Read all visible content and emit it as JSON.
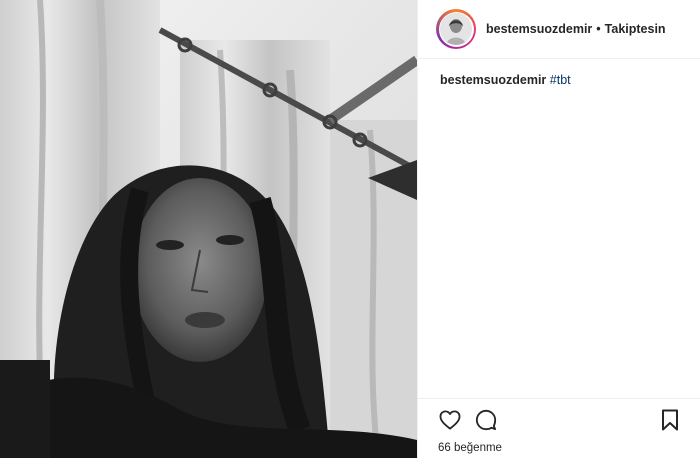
{
  "post": {
    "username": "bestemsuozdemir",
    "separator": "•",
    "follow_status": "Takiptesin",
    "caption": {
      "username": "bestemsuozdemir",
      "hashtag": "#tbt"
    },
    "likes": {
      "count": "66",
      "label": "beğenme"
    }
  },
  "icons": {
    "like": "heart-icon",
    "comment": "comment-icon",
    "save": "bookmark-icon"
  },
  "colors": {
    "text": "#262626",
    "hashtag": "#003569",
    "border": "#efefef"
  }
}
